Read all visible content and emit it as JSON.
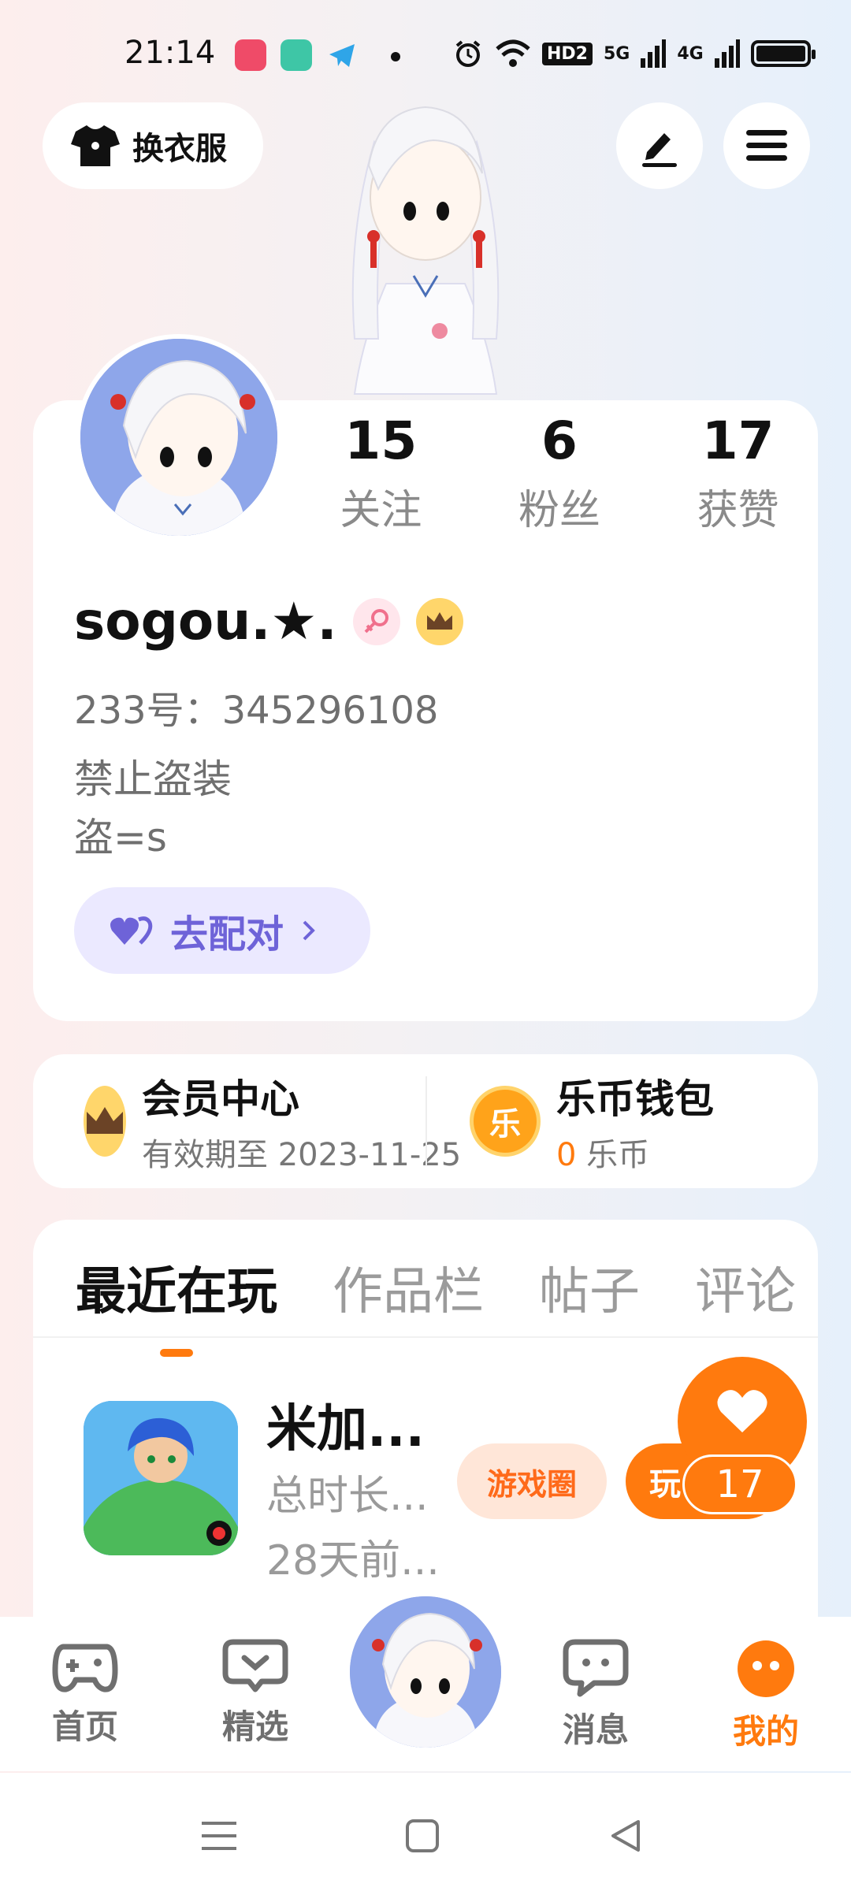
{
  "status_bar": {
    "time": "21:14",
    "network_labels": [
      "HD2",
      "5G",
      "4G"
    ]
  },
  "top_bar": {
    "dress_up_label": "换衣服",
    "edit_icon": "pen-icon",
    "menu_icon": "hamburger-icon"
  },
  "profile": {
    "stats": [
      {
        "value": "15",
        "label": "关注"
      },
      {
        "value": "6",
        "label": "粉丝"
      },
      {
        "value": "17",
        "label": "获赞"
      }
    ],
    "username": "sogou.★.",
    "id_text": "233号：345296108",
    "bio_lines": [
      "禁止盗装",
      "盗=s"
    ],
    "match_button": "去配对"
  },
  "membership": {
    "vip_title": "会员中心",
    "vip_sub": "有效期至 2023-11-25",
    "wallet_title": "乐币钱包",
    "wallet_amount": "0",
    "wallet_unit": "乐币",
    "coin_char": "乐"
  },
  "tabs": [
    "最近在玩",
    "作品栏",
    "帖子",
    "评论"
  ],
  "recent_game": {
    "name": "米加...",
    "play_time": "总时长...",
    "last_played": "28天前...",
    "circle_button": "游戏圈",
    "play_button": "玩"
  },
  "like": {
    "count": "17"
  },
  "bottom_nav": [
    {
      "label": "首页",
      "icon": "gamepad-icon"
    },
    {
      "label": "精选",
      "icon": "heart-chat-icon"
    },
    {
      "label": "消息",
      "icon": "message-icon"
    },
    {
      "label": "我的",
      "icon": "smile-icon"
    }
  ],
  "colors": {
    "accent": "#ff7a0e",
    "match": "#6e63d8"
  }
}
